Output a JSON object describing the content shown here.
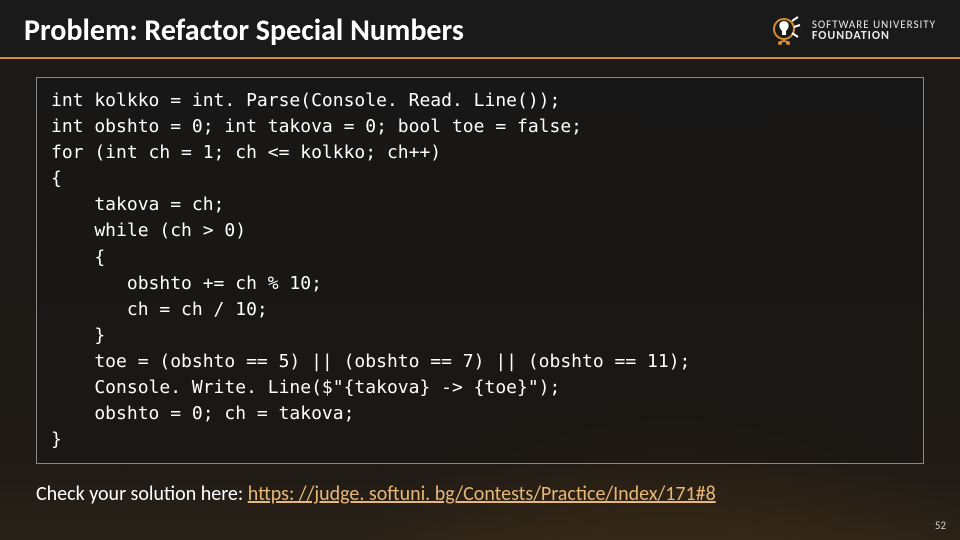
{
  "header": {
    "title": "Problem: Refactor Special Numbers",
    "logo": {
      "line1": "SOFTWARE UNIVERSITY",
      "line2": "FOUNDATION",
      "icon_name": "lightbulb-logo-icon"
    }
  },
  "code": {
    "lines": [
      "int kolkko = int. Parse(Console. Read. Line());",
      "int obshto = 0; int takova = 0; bool toe = false;",
      "for (int ch = 1; ch <= kolkko; ch++)",
      "{",
      "    takova = ch;",
      "    while (ch > 0)",
      "    {",
      "       obshto += ch % 10;",
      "       ch = ch / 10;",
      "    }",
      "    toe = (obshto == 5) || (obshto == 7) || (obshto == 11);",
      "    Console. Write. Line($\"{takova} -> {toe}\");",
      "    obshto = 0; ch = takova;",
      "}"
    ]
  },
  "footer": {
    "prefix": "Check your solution here: ",
    "link_text": "https: //judge. softuni. bg/Contests/Practice/Index/171#8",
    "link_href": "https://judge.softuni.bg/Contests/Practice/Index/171#8"
  },
  "page_number": "52"
}
